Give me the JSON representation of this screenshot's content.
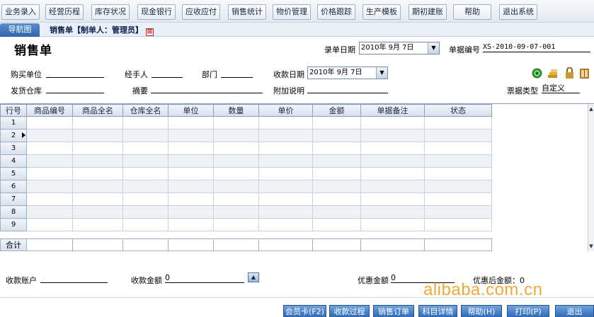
{
  "menu": [
    "业务录入",
    "经营历程",
    "库存状况",
    "现金银行",
    "应收应付",
    "销售统计",
    "物价管理",
    "价格跟踪",
    "生产模板",
    "期初建账",
    "帮助",
    "退出系统"
  ],
  "nav": {
    "home_tab": "导航图",
    "doc_tab": "销售单【制单人：管理员】",
    "close_glyph": "⊠"
  },
  "form": {
    "title": "销售单",
    "entry_date_label": "录单日期",
    "entry_date_value": "2010年 9月 7日",
    "doc_no_label": "单据编号",
    "doc_no_value": "XS-2010-09-07-001",
    "buyer_label": "购买单位",
    "handler_label": "经手人",
    "dept_label": "部门",
    "receipt_date_label": "收款日期",
    "receipt_date_value": "2010年 9月 7日",
    "warehouse_label": "发货仓库",
    "summary_label": "摘要",
    "note_label": "附加说明",
    "bill_type_label": "票据类型",
    "bill_type_value": "自定义"
  },
  "icons": {
    "refresh": "refresh-icon",
    "stack": "stack-icon",
    "lock": "lock-icon",
    "book": "book-icon"
  },
  "grid": {
    "columns": [
      "行号",
      "商品编号",
      "商品全名",
      "仓库全名",
      "单位",
      "数量",
      "单价",
      "金额",
      "单据备注",
      "状态"
    ],
    "rows": [
      "1",
      "2",
      "3",
      "4",
      "5",
      "6",
      "7",
      "8",
      "9"
    ],
    "current_row": 2,
    "total_label": "合计"
  },
  "bottom": {
    "account_label": "收款账户",
    "amount_label": "收款金额",
    "amount_value": "0",
    "discount_label": "优惠金额",
    "discount_value": "0",
    "after_discount_label": "优惠后金额：",
    "after_discount_value": "0"
  },
  "buttons": [
    "会员卡(F2)",
    "收款过程",
    "销售订单",
    "科目详情",
    "帮助(H)",
    "打印(P)",
    "退出"
  ],
  "watermark": "alibaba.com.cn"
}
